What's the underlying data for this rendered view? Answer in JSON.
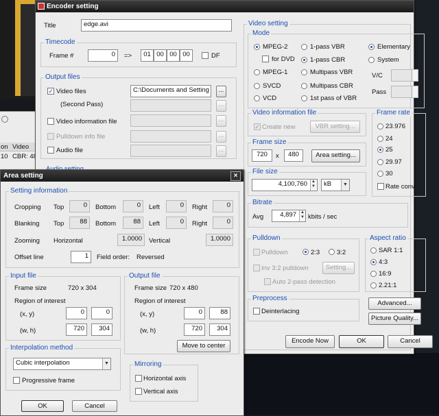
{
  "encoder": {
    "title": "Encoder setting",
    "title_label": "Title",
    "title_value": "edge.avi",
    "timecode": {
      "group": "Timecode",
      "frame_label": "Frame #",
      "frame_value": "0",
      "arrow": "=>",
      "hh": "01",
      "mm": "00",
      "ss": "00",
      "ff": "00",
      "df_label": "DF"
    },
    "output_files": {
      "group": "Output files",
      "video_files": "Video files",
      "video_path": "C:\\Documents and Setting",
      "second_pass": "(Second Pass)",
      "video_info_file": "Video information file",
      "pulldown_info_file": "Pulldown info file",
      "audio_file": "Audio file",
      "browse": "..."
    },
    "audio_setting_partial": "Audio setting",
    "video_setting": {
      "group": "Video setting",
      "mode": {
        "group": "Mode",
        "mpeg2": "MPEG-2",
        "for_dvd": "for DVD",
        "mpeg1": "MPEG-1",
        "svcd": "SVCD",
        "vcd": "VCD",
        "vbr1": "1-pass VBR",
        "cbr1": "1-pass CBR",
        "multi_vbr": "Multipass VBR",
        "multi_cbr": "Multipass CBR",
        "first_vbr": "1st pass of VBR",
        "elementary": "Elementary",
        "system": "System",
        "vc": "V/C",
        "pass": "Pass"
      },
      "video_info": {
        "group": "Video information file",
        "create_new": "Create new",
        "vbr_setting": "VBR setting..."
      },
      "frame_size": {
        "group": "Frame size",
        "w": "720",
        "x": "x",
        "h": "480",
        "area_button": "Area setting..."
      },
      "file_size": {
        "group": "File size",
        "value": "4,100,760",
        "unit": "kB"
      },
      "bitrate": {
        "group": "Bitrate",
        "avg": "Avg",
        "value": "4,897",
        "unit": "kbits / sec"
      },
      "pulldown": {
        "group": "Pulldown",
        "pulldown": "Pulldown",
        "r23": "2:3",
        "r32": "3:2",
        "inv": "Inv 3:2 pulldown",
        "setting": "Setting...",
        "auto2": "Auto 2-pass detection"
      },
      "preprocess": {
        "group": "Preprocess",
        "deinterlacing": "Deinterlacing"
      },
      "frame_rate": {
        "group": "Frame rate",
        "options": [
          "23.976",
          "24",
          "25",
          "29.97",
          "30"
        ],
        "rate_conv": "Rate conv"
      },
      "aspect": {
        "group": "Aspect ratio",
        "options": [
          "SAR 1:1",
          "4:3",
          "16:9",
          "2.21:1"
        ]
      },
      "advanced": "Advanced...",
      "picture_quality": "Picture Quality..."
    },
    "encode_now": "Encode Now",
    "ok": "OK",
    "cancel": "Cancel"
  },
  "area": {
    "title": "Area setting",
    "close": "×",
    "setting_info": {
      "group": "Setting information",
      "cropping": "Cropping",
      "blanking": "Blanking",
      "zooming": "Zooming",
      "offset": "Offset line",
      "top": "Top",
      "bottom": "Bottom",
      "left": "Left",
      "right": "Right",
      "crop_top": "0",
      "crop_bottom": "0",
      "crop_left": "0",
      "crop_right": "0",
      "blank_top": "88",
      "blank_bottom": "88",
      "blank_left": "0",
      "blank_right": "0",
      "horizontal": "Horizontal",
      "vertical": "Vertical",
      "zoom_h": "1.0000",
      "zoom_v": "1.0000",
      "offset_value": "1",
      "field_order_label": "Field order:",
      "field_order_value": "Reversed"
    },
    "input_file": {
      "group": "Input file",
      "frame_size_label": "Frame size",
      "frame_size_value": "720 x 304",
      "roi": "Region of interest",
      "xy": "(x, y)",
      "wh": "(w, h)",
      "x": "0",
      "y": "0",
      "w": "720",
      "h": "304"
    },
    "output_file": {
      "group": "Output file",
      "frame_size_label": "Frame size",
      "frame_size_value": "720 x 480",
      "roi": "Region of interest",
      "xy": "(x, y)",
      "wh": "(w, h)",
      "x": "0",
      "y": "88",
      "w": "720",
      "h": "304",
      "move_center": "Move to center"
    },
    "interp": {
      "group": "Interpolation method",
      "value": "Cubic interpolation",
      "progressive": "Progressive frame"
    },
    "mirroring": {
      "group": "Mirroring",
      "horizontal": "Horizontal axis",
      "vertical": "Vertical axis"
    },
    "ok": "OK",
    "cancel": "Cancel"
  },
  "background": {
    "col1": "on",
    "col2": "Video",
    "row1": "10",
    "row2": "CBR: 48"
  }
}
